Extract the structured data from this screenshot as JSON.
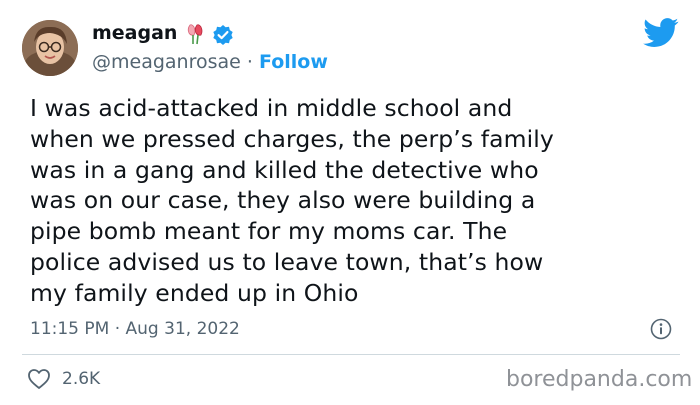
{
  "tweet": {
    "author": {
      "display_name": "meagan",
      "handle": "@meaganrosae",
      "separator": "·",
      "follow_label": "Follow",
      "verified": true
    },
    "text": "I was acid-attacked in middle school and\nwhen we pressed charges, the perp’s family\nwas in a gang and killed the detective who\nwas on our case, they also were building a\npipe bomb meant for my moms car. The\npolice advised us to leave town, that’s how\nmy family ended up in Ohio",
    "timestamp": "11:15 PM · Aug 31, 2022",
    "likes": "2.6K"
  },
  "watermark": "boredpanda.com",
  "colors": {
    "accent": "#1d9bf0",
    "text": "#0f1419",
    "secondary": "#536471",
    "divider": "#cfd9de",
    "watermark": "#8f9297"
  },
  "icons": {
    "brand": "twitter-bird-icon",
    "verified": "verified-badge-icon",
    "emoji": "rose-emoji-icon",
    "info": "info-icon",
    "like": "heart-icon"
  }
}
